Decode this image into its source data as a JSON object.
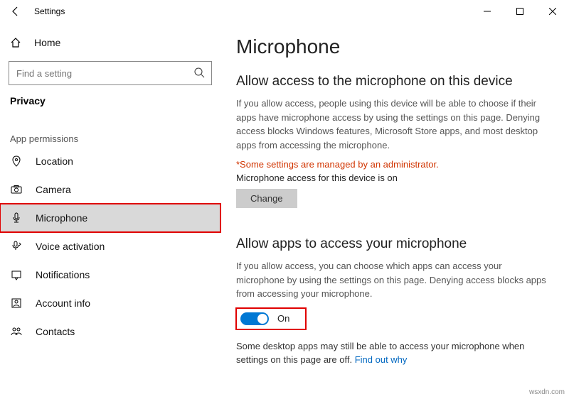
{
  "titlebar": {
    "back_aria": "Back",
    "title": "Settings"
  },
  "sidebar": {
    "home_label": "Home",
    "search_placeholder": "Find a setting",
    "category_label": "Privacy",
    "group_label": "App permissions",
    "items": [
      {
        "label": "Location"
      },
      {
        "label": "Camera"
      },
      {
        "label": "Microphone"
      },
      {
        "label": "Voice activation"
      },
      {
        "label": "Notifications"
      },
      {
        "label": "Account info"
      },
      {
        "label": "Contacts"
      }
    ]
  },
  "content": {
    "page_title": "Microphone",
    "sec1_title": "Allow access to the microphone on this device",
    "sec1_desc": "If you allow access, people using this device will be able to choose if their apps have microphone access by using the settings on this page. Denying access blocks Windows features, Microsoft Store apps, and most desktop apps from accessing the microphone.",
    "admin_warning": "*Some settings are managed by an administrator.",
    "device_status": "Microphone access for this device is on",
    "change_label": "Change",
    "sec2_title": "Allow apps to access your microphone",
    "sec2_desc": "If you allow access, you can choose which apps can access your microphone by using the settings on this page. Denying access blocks apps from accessing your microphone.",
    "toggle_state": "On",
    "footer_desc": "Some desktop apps may still be able to access your microphone when settings on this page are off. ",
    "footer_link": "Find out why"
  },
  "watermark": "wsxdn.com"
}
